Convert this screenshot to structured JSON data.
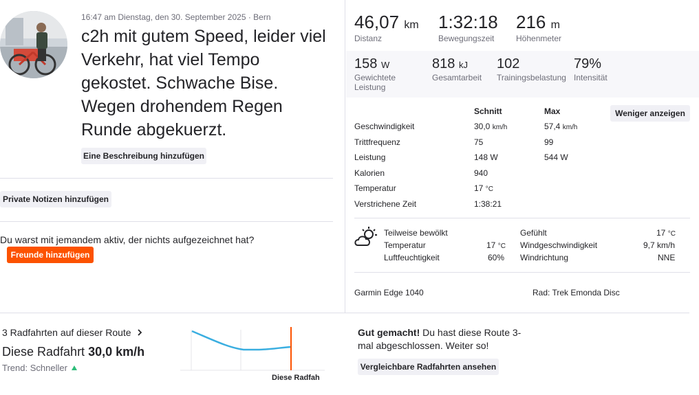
{
  "header": {
    "meta": "16:47 am Dienstag, den 30. September 2025 · Bern",
    "title": "c2h mit gutem Speed, leider viel Verkehr, hat viel Tempo gekostet. Schwache Bise. Wegen drohendem Regen Runde abgekuerzt.",
    "add_description": "Eine Beschreibung hinzufügen"
  },
  "notes": {
    "private_notes_label": "Private Notizen hinzufügen",
    "with_someone_text": "Du warst mit jemandem aktiv, der nichts aufgezeichnet hat?",
    "add_friends_label": "Freunde hinzufügen"
  },
  "primary_stats": [
    {
      "value": "46,07",
      "unit": "km",
      "label": "Distanz"
    },
    {
      "value": "1:32:18",
      "unit": "",
      "label": "Bewegungszeit"
    },
    {
      "value": "216",
      "unit": "m",
      "label": "Höhenmeter"
    }
  ],
  "secondary_stats": [
    {
      "value": "158",
      "unit": "W",
      "label": "Gewichtete Leistung"
    },
    {
      "value": "818",
      "unit": "kJ",
      "label": "Gesamtarbeit"
    },
    {
      "value": "102",
      "unit": "",
      "label": "Trainingsbelastung"
    },
    {
      "value": "79%",
      "unit": "",
      "label": "Intensität"
    }
  ],
  "details": {
    "col_avg": "Schnitt",
    "col_max": "Max",
    "less_label": "Weniger anzeigen",
    "rows": [
      {
        "label": "Geschwindigkeit",
        "avg": "30,0",
        "avg_unit": "km/h",
        "max": "57,4",
        "max_unit": "km/h"
      },
      {
        "label": "Trittfrequenz",
        "avg": "75",
        "avg_unit": "",
        "max": "99",
        "max_unit": ""
      },
      {
        "label": "Leistung",
        "avg": "148 W",
        "avg_unit": "",
        "max": "544 W",
        "max_unit": ""
      },
      {
        "label": "Kalorien",
        "avg": "940",
        "avg_unit": "",
        "max": "",
        "max_unit": ""
      },
      {
        "label": "Temperatur",
        "avg": "17",
        "avg_unit": "°C",
        "max": "",
        "max_unit": ""
      },
      {
        "label": "Verstrichene Zeit",
        "avg": "1:38:21",
        "avg_unit": "",
        "max": "",
        "max_unit": ""
      }
    ]
  },
  "weather": {
    "icon": "partly-cloudy-icon",
    "condition": "Teilweise bewölkt",
    "temp_label": "Temperatur",
    "temp_value": "17",
    "temp_unit": "°C",
    "humidity_label": "Luftfeuchtigkeit",
    "humidity_value": "60%",
    "feels_label": "Gefühlt",
    "feels_value": "17",
    "feels_unit": "°C",
    "wind_speed_label": "Windgeschwindigkeit",
    "wind_speed_value": "9,7 km/h",
    "wind_dir_label": "Windrichtung",
    "wind_dir_value": "NNE"
  },
  "equipment": {
    "device": "Garmin Edge 1040",
    "bike": "Rad: Trek Emonda Disc"
  },
  "route": {
    "count_label": "3 Radfahrten auf dieser Route",
    "speed_label": "Diese Radfahrt",
    "speed_value": "30,0 km/h",
    "trend_label": "Trend:",
    "trend_value": "Schneller",
    "chart_caption": "Diese Radfah",
    "congrats_bold": "Gut gemacht!",
    "congrats_text": "Du hast diese Route 3-mal abgeschlossen. Weiter so!",
    "compare_label": "Vergleichbare Radfahrten ansehen"
  },
  "colors": {
    "accent": "#fc5200",
    "chart_line": "#3aaee0",
    "trend_up": "#2ebd7a"
  }
}
